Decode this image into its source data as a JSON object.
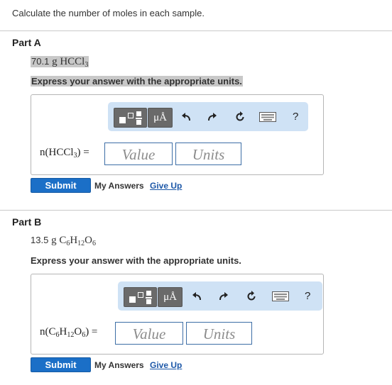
{
  "intro": "Calculate the number of moles in each sample.",
  "partA": {
    "title": "Part A",
    "sample": {
      "mass": "70.1",
      "g": "g",
      "formula": "HCCl",
      "sub": "3"
    },
    "instruction": "Express your answer with the appropriate units.",
    "toolbar": {
      "units_btn": "μÅ",
      "help": "?"
    },
    "label": {
      "prefix": "n(HCCl",
      "sub": "3",
      "suffix": ") ="
    },
    "value_placeholder": "Value",
    "units_placeholder": "Units",
    "submit": "Submit",
    "my_answers": "My Answers",
    "give_up": "Give Up"
  },
  "partB": {
    "title": "Part B",
    "sample": {
      "mass": "13.5",
      "g": "g",
      "c": "C",
      "c_sub": "6",
      "h": "H",
      "h_sub": "12",
      "o": "O",
      "o_sub": "6"
    },
    "instruction": "Express your answer with the appropriate units.",
    "toolbar": {
      "units_btn": "μÅ",
      "help": "?"
    },
    "label": {
      "prefix": "n(C",
      "c_sub": "6",
      "h": "H",
      "h_sub": "12",
      "o": "O",
      "o_sub": "6",
      "suffix": ") ="
    },
    "value_placeholder": "Value",
    "units_placeholder": "Units",
    "submit": "Submit",
    "my_answers": "My Answers",
    "give_up": "Give Up"
  },
  "colors": {
    "toolbar_bg": "#cfe2f5",
    "submit_bg": "#1b6fc7",
    "link": "#1d58a8",
    "highlight": "#c8c8c8"
  },
  "icons": [
    "templates-icon",
    "units-icon",
    "undo-icon",
    "redo-icon",
    "reset-icon",
    "keyboard-icon",
    "help-icon"
  ]
}
